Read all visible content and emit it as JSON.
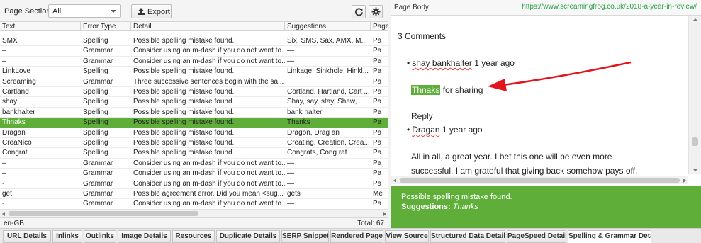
{
  "toolbar": {
    "page_section_label": "Page Section:",
    "page_section_value": "All",
    "export_label": "Export"
  },
  "table": {
    "columns": [
      "Text",
      "Error Type",
      "Detail",
      "Suggestions",
      "Page"
    ],
    "rows": [
      {
        "text": "SMX",
        "type": "Spelling",
        "detail": "Possible spelling mistake found.",
        "sugg": "Six, SMS, Sax, AMX, M...",
        "page": "Pa"
      },
      {
        "text": "–",
        "type": "Grammar",
        "detail": "Consider using an m-dash if you do not want to...",
        "sugg": "—",
        "page": "Pa"
      },
      {
        "text": "–",
        "type": "Grammar",
        "detail": "Consider using an m-dash if you do not want to...",
        "sugg": "—",
        "page": "Pa"
      },
      {
        "text": "LinkLove",
        "type": "Spelling",
        "detail": "Possible spelling mistake found.",
        "sugg": "Linkage, Sinkhole, Hinkl...",
        "page": "Pa"
      },
      {
        "text": "Screaming",
        "type": "Grammar",
        "detail": "Three successive sentences begin with the sa...",
        "sugg": "",
        "page": "Pa"
      },
      {
        "text": "Cartland",
        "type": "Spelling",
        "detail": "Possible spelling mistake found.",
        "sugg": "Cortland, Hartland, Cart ...",
        "page": "Pa"
      },
      {
        "text": "shay",
        "type": "Spelling",
        "detail": "Possible spelling mistake found.",
        "sugg": "Shay, say, stay, Shaw, ...",
        "page": "Pa"
      },
      {
        "text": "bankhalter",
        "type": "Spelling",
        "detail": "Possible spelling mistake found.",
        "sugg": "bank halter",
        "page": "Pa"
      },
      {
        "text": "Thnaks",
        "type": "Spelling",
        "detail": "Possible spelling mistake found.",
        "sugg": "Thanks",
        "page": "Pa",
        "selected": true
      },
      {
        "text": "Dragan",
        "type": "Spelling",
        "detail": "Possible spelling mistake found.",
        "sugg": "Dragon, Drag an",
        "page": "Pa"
      },
      {
        "text": "CreaNico",
        "type": "Spelling",
        "detail": "Possible spelling mistake found.",
        "sugg": "Creating, Creation, Crea...",
        "page": "Pa"
      },
      {
        "text": "Congrat",
        "type": "Spelling",
        "detail": "Possible spelling mistake found.",
        "sugg": "Congrats, Cong rat",
        "page": "Pa"
      },
      {
        "text": "–",
        "type": "Grammar",
        "detail": "Consider using an m-dash if you do not want to...",
        "sugg": "—",
        "page": "Pa"
      },
      {
        "text": "–",
        "type": "Grammar",
        "detail": "Consider using an m-dash if you do not want to...",
        "sugg": "—",
        "page": "Pa"
      },
      {
        "text": "-",
        "type": "Grammar",
        "detail": "Consider using an m-dash if you do not want to...",
        "sugg": "—",
        "page": "Pa"
      },
      {
        "text": "get",
        "type": "Grammar",
        "detail": "Possible agreement error. Did you mean <sug...",
        "sugg": "gets",
        "page": "Me"
      },
      {
        "text": "-",
        "type": "Grammar",
        "detail": "Consider using an m-dash if you do not want to...",
        "sugg": "—",
        "page": "Pa"
      }
    ]
  },
  "status": {
    "locale": "en-GB",
    "total": "Total:  67"
  },
  "right_panel": {
    "title": "Page Body",
    "url": "https://www.screamingfrog.co.uk/2018-a-year-in-review/",
    "comments_heading": "3 Comments",
    "comment1_author": "shay bankhalter",
    "comment1_time": " 1 year ago",
    "comment1_misspelled": "Thnaks",
    "comment1_rest": " for sharing",
    "reply_label": "Reply",
    "comment2_author": "Dragan",
    "comment2_time": " 1 year ago",
    "comment2_text": "All in all, a great year. I bet this one will be even more successful. I am grateful that giving back somehow pays off.",
    "info_message": "Possible spelling mistake found.",
    "info_suggestions_label": "Suggestions:",
    "info_suggestions_value": "Thanks"
  },
  "tabs": [
    "URL Details",
    "Inlinks",
    "Outlinks",
    "Image Details",
    "Resources",
    "Duplicate Details",
    "SERP Snippet",
    "Rendered Page",
    "View Source",
    "Structured Data Details",
    "PageSpeed Details",
    "Spelling & Grammar Details"
  ],
  "active_tab": "Spelling & Grammar Details",
  "colors": {
    "accent_green": "#5fae3a",
    "url_green": "#2ba04a",
    "arrow_red": "#e0151d"
  }
}
